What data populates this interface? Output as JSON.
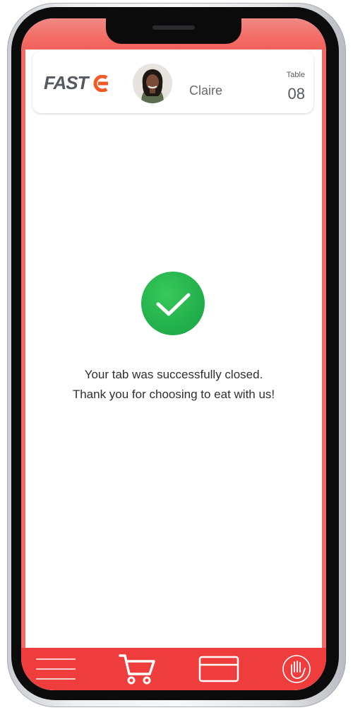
{
  "header": {
    "logo_text": "FAST",
    "user_name": "Claire",
    "table_label": "Table",
    "table_number": "08"
  },
  "message": {
    "line1": "Your tab was successfully closed.",
    "line2": "Thank you for choosing to eat with us!"
  },
  "icons": {
    "success": "check-circle-icon",
    "menu": "hamburger-menu-icon",
    "cart": "shopping-cart-icon",
    "payment": "credit-card-icon",
    "waiter": "hand-raise-icon"
  },
  "colors": {
    "accent_red": "#ee3d3c",
    "success_green": "#22b14c",
    "logo_gray": "#555a60",
    "logo_orange": "#f15a24"
  }
}
